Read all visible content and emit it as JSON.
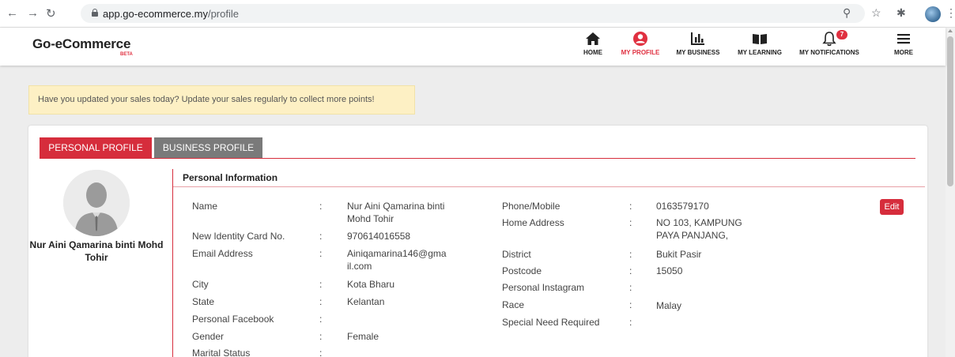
{
  "browser": {
    "url_host": "app.go-ecommerce.my",
    "url_path": "/profile"
  },
  "header": {
    "brand": "Go-eCommerce",
    "beta": "BETA",
    "nav": [
      {
        "label": "HOME",
        "icon": "home-icon"
      },
      {
        "label": "MY PROFILE",
        "icon": "user-icon",
        "active": true
      },
      {
        "label": "MY BUSINESS",
        "icon": "bar-chart-icon"
      },
      {
        "label": "MY LEARNING",
        "icon": "book-icon"
      },
      {
        "label": "MY NOTIFICATIONS",
        "icon": "bell-icon",
        "badge": "7"
      },
      {
        "label": "MORE",
        "icon": "hamburger-icon"
      }
    ]
  },
  "banner": {
    "text": "Have you updated your sales today? Update your sales regularly to collect more points!"
  },
  "tabs": {
    "personal": "PERSONAL PROFILE",
    "business": "BUSINESS PROFILE"
  },
  "profile": {
    "name": "Nur Aini Qamarina binti Mohd Tohir"
  },
  "section": {
    "title": "Personal Information",
    "edit": "Edit"
  },
  "fields_left": [
    {
      "label": "Name",
      "value": "Nur Aini Qamarina binti Mohd Tohir"
    },
    {
      "label": "New Identity Card No.",
      "value": "970614016558"
    },
    {
      "label": "Email Address",
      "value": "Ainiqamarina146@gmail.com"
    },
    {
      "label": "City",
      "value": "Kota Bharu"
    },
    {
      "label": "State",
      "value": "Kelantan"
    },
    {
      "label": "Personal Facebook",
      "value": ""
    },
    {
      "label": "Gender",
      "value": "Female"
    },
    {
      "label": "Marital Status",
      "value": ""
    }
  ],
  "fields_right": [
    {
      "label": "Phone/Mobile",
      "value": "0163579170"
    },
    {
      "label": "Home Address",
      "value": "NO 103, KAMPUNG PAYA PANJANG,"
    },
    {
      "label": "District",
      "value": "Bukit Pasir"
    },
    {
      "label": "Postcode",
      "value": "15050"
    },
    {
      "label": "Personal Instagram",
      "value": ""
    },
    {
      "label": "Race",
      "value": "Malay"
    },
    {
      "label": "Special Need Required",
      "value": ""
    }
  ],
  "colors": {
    "accent": "#d62d3c",
    "banner_bg": "#fdf0c4",
    "tab_inactive": "#7a7a7a"
  }
}
